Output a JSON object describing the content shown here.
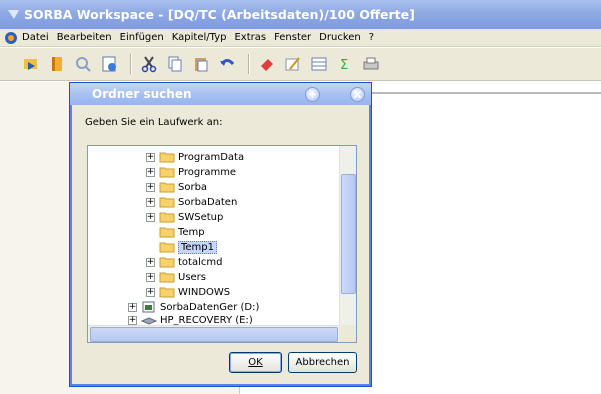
{
  "window": {
    "title": "SORBA Workspace - [DQ/TC (Arbeitsdaten)/100 Offerte]"
  },
  "menu": [
    {
      "label": "Datei"
    },
    {
      "label": "Bearbeiten"
    },
    {
      "label": "Einfügen"
    },
    {
      "label": "Kapitel/Typ"
    },
    {
      "label": "Extras"
    },
    {
      "label": "Fenster"
    },
    {
      "label": "Drucken"
    },
    {
      "label": "?"
    }
  ],
  "toolbar": {
    "icons": [
      "open-icon",
      "book-icon",
      "zoom-icon",
      "page-icon",
      "cut-icon",
      "copy-icon",
      "paste-icon",
      "undo-icon",
      "eraser-icon",
      "edit-icon",
      "table-icon",
      "sum-icon",
      "print-icon"
    ]
  },
  "dialog": {
    "title": "Ordner suchen",
    "prompt": "Geben Sie ein Laufwerk an:",
    "ok_label": "OK",
    "cancel_label": "Abbrechen",
    "tree": [
      {
        "label": "ProgramData",
        "expandable": true,
        "icon": "folder-icon"
      },
      {
        "label": "Programme",
        "expandable": true,
        "icon": "folder-icon"
      },
      {
        "label": "Sorba",
        "expandable": true,
        "icon": "folder-icon"
      },
      {
        "label": "SorbaDaten",
        "expandable": true,
        "icon": "folder-icon"
      },
      {
        "label": "SWSetup",
        "expandable": true,
        "icon": "folder-icon"
      },
      {
        "label": "Temp",
        "expandable": false,
        "icon": "folder-icon"
      },
      {
        "label": "Temp1",
        "expandable": false,
        "icon": "folder-icon",
        "selected": true
      },
      {
        "label": "totalcmd",
        "expandable": true,
        "icon": "folder-icon"
      },
      {
        "label": "Users",
        "expandable": true,
        "icon": "folder-icon"
      },
      {
        "label": "WINDOWS",
        "expandable": true,
        "icon": "folder-icon"
      },
      {
        "label": "SorbaDatenGer (D:)",
        "expandable": true,
        "icon": "drive-icon"
      },
      {
        "label": "HP_RECOVERY (E:)",
        "expandable": true,
        "icon": "drive-icon"
      }
    ]
  },
  "colors": {
    "title_bar": "#8fa9e3",
    "dialog_border": "#1c4fd1",
    "selection": "#c6d7f3"
  }
}
